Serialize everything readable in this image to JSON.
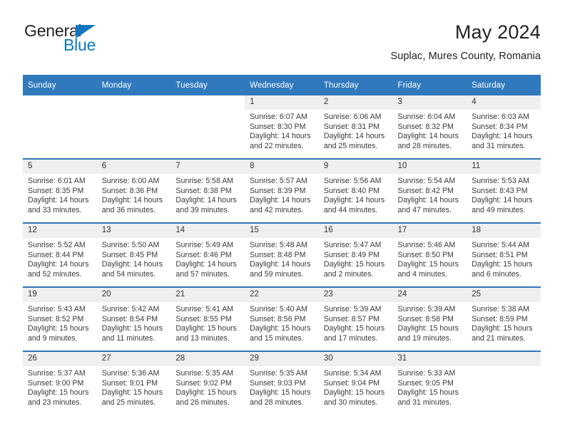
{
  "brand": {
    "name_top": "General",
    "name_bottom": "Blue",
    "triangle_icon": "triangle-icon",
    "accent_color": "#1277bc"
  },
  "header": {
    "title": "May 2024",
    "subtitle": "Suplac, Mures County, Romania"
  },
  "theme": {
    "header_blue": "#3079bd",
    "divider_blue": "#2e75b6",
    "daynum_band": "#efefef",
    "text": "#333333"
  },
  "calendar": {
    "weekday_headers": [
      "Sunday",
      "Monday",
      "Tuesday",
      "Wednesday",
      "Thursday",
      "Friday",
      "Saturday"
    ],
    "labels": {
      "sunrise": "Sunrise:",
      "sunset": "Sunset:",
      "daylight": "Daylight:"
    },
    "weeks": [
      [
        {
          "day": "",
          "blank": true
        },
        {
          "day": "",
          "blank": true
        },
        {
          "day": "",
          "blank": true
        },
        {
          "day": "1",
          "sunrise": "Sunrise: 6:07 AM",
          "sunset": "Sunset: 8:30 PM",
          "daylight": "Daylight: 14 hours and 22 minutes."
        },
        {
          "day": "2",
          "sunrise": "Sunrise: 6:06 AM",
          "sunset": "Sunset: 8:31 PM",
          "daylight": "Daylight: 14 hours and 25 minutes."
        },
        {
          "day": "3",
          "sunrise": "Sunrise: 6:04 AM",
          "sunset": "Sunset: 8:32 PM",
          "daylight": "Daylight: 14 hours and 28 minutes."
        },
        {
          "day": "4",
          "sunrise": "Sunrise: 6:03 AM",
          "sunset": "Sunset: 8:34 PM",
          "daylight": "Daylight: 14 hours and 31 minutes."
        }
      ],
      [
        {
          "day": "5",
          "sunrise": "Sunrise: 6:01 AM",
          "sunset": "Sunset: 8:35 PM",
          "daylight": "Daylight: 14 hours and 33 minutes."
        },
        {
          "day": "6",
          "sunrise": "Sunrise: 6:00 AM",
          "sunset": "Sunset: 8:36 PM",
          "daylight": "Daylight: 14 hours and 36 minutes."
        },
        {
          "day": "7",
          "sunrise": "Sunrise: 5:58 AM",
          "sunset": "Sunset: 8:38 PM",
          "daylight": "Daylight: 14 hours and 39 minutes."
        },
        {
          "day": "8",
          "sunrise": "Sunrise: 5:57 AM",
          "sunset": "Sunset: 8:39 PM",
          "daylight": "Daylight: 14 hours and 42 minutes."
        },
        {
          "day": "9",
          "sunrise": "Sunrise: 5:56 AM",
          "sunset": "Sunset: 8:40 PM",
          "daylight": "Daylight: 14 hours and 44 minutes."
        },
        {
          "day": "10",
          "sunrise": "Sunrise: 5:54 AM",
          "sunset": "Sunset: 8:42 PM",
          "daylight": "Daylight: 14 hours and 47 minutes."
        },
        {
          "day": "11",
          "sunrise": "Sunrise: 5:53 AM",
          "sunset": "Sunset: 8:43 PM",
          "daylight": "Daylight: 14 hours and 49 minutes."
        }
      ],
      [
        {
          "day": "12",
          "sunrise": "Sunrise: 5:52 AM",
          "sunset": "Sunset: 8:44 PM",
          "daylight": "Daylight: 14 hours and 52 minutes."
        },
        {
          "day": "13",
          "sunrise": "Sunrise: 5:50 AM",
          "sunset": "Sunset: 8:45 PM",
          "daylight": "Daylight: 14 hours and 54 minutes."
        },
        {
          "day": "14",
          "sunrise": "Sunrise: 5:49 AM",
          "sunset": "Sunset: 8:46 PM",
          "daylight": "Daylight: 14 hours and 57 minutes."
        },
        {
          "day": "15",
          "sunrise": "Sunrise: 5:48 AM",
          "sunset": "Sunset: 8:48 PM",
          "daylight": "Daylight: 14 hours and 59 minutes."
        },
        {
          "day": "16",
          "sunrise": "Sunrise: 5:47 AM",
          "sunset": "Sunset: 8:49 PM",
          "daylight": "Daylight: 15 hours and 2 minutes."
        },
        {
          "day": "17",
          "sunrise": "Sunrise: 5:46 AM",
          "sunset": "Sunset: 8:50 PM",
          "daylight": "Daylight: 15 hours and 4 minutes."
        },
        {
          "day": "18",
          "sunrise": "Sunrise: 5:44 AM",
          "sunset": "Sunset: 8:51 PM",
          "daylight": "Daylight: 15 hours and 6 minutes."
        }
      ],
      [
        {
          "day": "19",
          "sunrise": "Sunrise: 5:43 AM",
          "sunset": "Sunset: 8:52 PM",
          "daylight": "Daylight: 15 hours and 9 minutes."
        },
        {
          "day": "20",
          "sunrise": "Sunrise: 5:42 AM",
          "sunset": "Sunset: 8:54 PM",
          "daylight": "Daylight: 15 hours and 11 minutes."
        },
        {
          "day": "21",
          "sunrise": "Sunrise: 5:41 AM",
          "sunset": "Sunset: 8:55 PM",
          "daylight": "Daylight: 15 hours and 13 minutes."
        },
        {
          "day": "22",
          "sunrise": "Sunrise: 5:40 AM",
          "sunset": "Sunset: 8:56 PM",
          "daylight": "Daylight: 15 hours and 15 minutes."
        },
        {
          "day": "23",
          "sunrise": "Sunrise: 5:39 AM",
          "sunset": "Sunset: 8:57 PM",
          "daylight": "Daylight: 15 hours and 17 minutes."
        },
        {
          "day": "24",
          "sunrise": "Sunrise: 5:39 AM",
          "sunset": "Sunset: 8:58 PM",
          "daylight": "Daylight: 15 hours and 19 minutes."
        },
        {
          "day": "25",
          "sunrise": "Sunrise: 5:38 AM",
          "sunset": "Sunset: 8:59 PM",
          "daylight": "Daylight: 15 hours and 21 minutes."
        }
      ],
      [
        {
          "day": "26",
          "sunrise": "Sunrise: 5:37 AM",
          "sunset": "Sunset: 9:00 PM",
          "daylight": "Daylight: 15 hours and 23 minutes."
        },
        {
          "day": "27",
          "sunrise": "Sunrise: 5:36 AM",
          "sunset": "Sunset: 9:01 PM",
          "daylight": "Daylight: 15 hours and 25 minutes."
        },
        {
          "day": "28",
          "sunrise": "Sunrise: 5:35 AM",
          "sunset": "Sunset: 9:02 PM",
          "daylight": "Daylight: 15 hours and 26 minutes."
        },
        {
          "day": "29",
          "sunrise": "Sunrise: 5:35 AM",
          "sunset": "Sunset: 9:03 PM",
          "daylight": "Daylight: 15 hours and 28 minutes."
        },
        {
          "day": "30",
          "sunrise": "Sunrise: 5:34 AM",
          "sunset": "Sunset: 9:04 PM",
          "daylight": "Daylight: 15 hours and 30 minutes."
        },
        {
          "day": "31",
          "sunrise": "Sunrise: 5:33 AM",
          "sunset": "Sunset: 9:05 PM",
          "daylight": "Daylight: 15 hours and 31 minutes."
        },
        {
          "day": "",
          "empty": true
        }
      ]
    ]
  }
}
